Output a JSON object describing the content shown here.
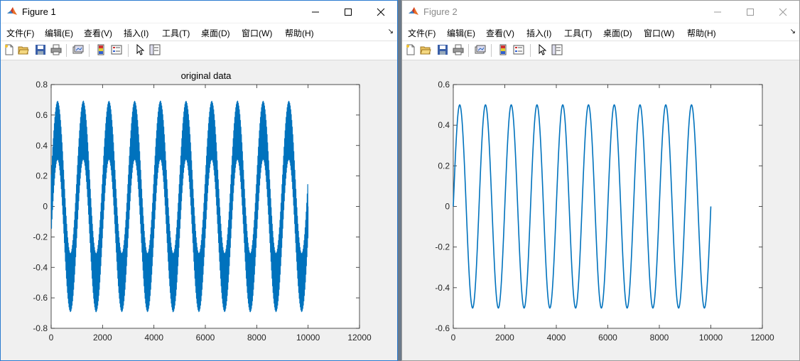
{
  "menu": [
    "文件(F)",
    "编辑(E)",
    "查看(V)",
    "插入(I)",
    "工具(T)",
    "桌面(D)",
    "窗口(W)",
    "帮助(H)"
  ],
  "colors": {
    "line": "#0072bd",
    "accent": "#2b7bd0"
  },
  "icons": [
    "new-file-icon",
    "open-folder-icon",
    "save-icon",
    "print-icon",
    "link-plot-icon",
    "colorbar-icon",
    "legend-icon",
    "pointer-icon",
    "property-inspector-icon"
  ],
  "window1": {
    "title": "Figure 1"
  },
  "window2": {
    "title": "Figure 2"
  },
  "chart_data": [
    {
      "type": "line",
      "title": "original data",
      "xlim": [
        0,
        12000
      ],
      "ylim": [
        -0.8,
        0.8
      ],
      "xticks": [
        "0",
        "2000",
        "4000",
        "6000",
        "8000",
        "10000",
        "12000"
      ],
      "yticks": [
        "0.8",
        "0.6",
        "0.4",
        "0.2",
        "0",
        "-0.2",
        "-0.4",
        "-0.6",
        "-0.8"
      ],
      "x": [
        0,
        10000
      ],
      "series": [
        {
          "signal": "0.5*sin(2*pi*x/1000) + 0.2*sin(2*pi*x/20)",
          "envelope_max": 0.7,
          "envelope_min": -0.7,
          "inner_peak": 0.3
        }
      ],
      "grid": false
    },
    {
      "type": "line",
      "title": "",
      "xlim": [
        0,
        12000
      ],
      "ylim": [
        -0.6,
        0.6
      ],
      "xticks": [
        "0",
        "2000",
        "4000",
        "6000",
        "8000",
        "10000",
        "12000"
      ],
      "yticks": [
        "0.6",
        "0.4",
        "0.2",
        "0",
        "-0.2",
        "-0.4",
        "-0.6"
      ],
      "x": [
        0,
        10000
      ],
      "series": [
        {
          "signal": "0.5*sin(2*pi*x/1000)",
          "amplitude": 0.5,
          "period": 1000
        }
      ],
      "grid": false
    }
  ]
}
